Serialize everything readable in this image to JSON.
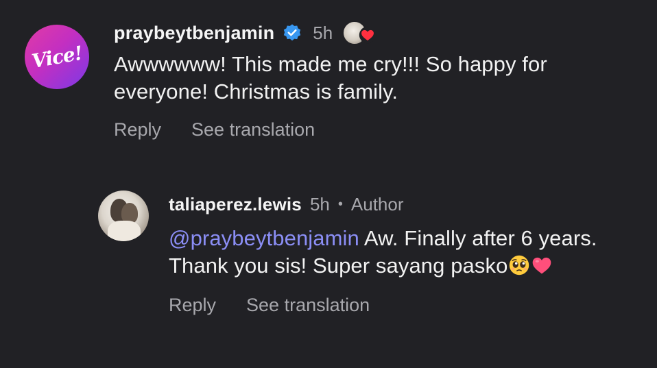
{
  "comments": [
    {
      "username": "praybeytbenjamin",
      "avatar_text": "Vice!",
      "verified": true,
      "verified_icon": "verified-badge-icon",
      "time": "5h",
      "liked_by_author": true,
      "text": "Awwwwww! This made me cry!!! So happy for everyone! Christmas is family.",
      "actions": {
        "reply": "Reply",
        "translate": "See translation"
      }
    },
    {
      "username": "taliaperez.lewis",
      "time": "5h",
      "separator": "•",
      "author_tag": "Author",
      "mention": "@praybeytbenjamin",
      "text": " Aw. Finally after 6 years. Thank you sis! Super sayang pasko",
      "emojis": [
        "pleading-face-icon",
        "pink-heart-icon"
      ],
      "actions": {
        "reply": "Reply",
        "translate": "See translation"
      }
    }
  ],
  "colors": {
    "background": "#212125",
    "text": "#f2f2f2",
    "muted": "#a8a8ad",
    "mention": "#8b8ef5",
    "verified": "#3897f0",
    "heart": "#ff3040"
  }
}
